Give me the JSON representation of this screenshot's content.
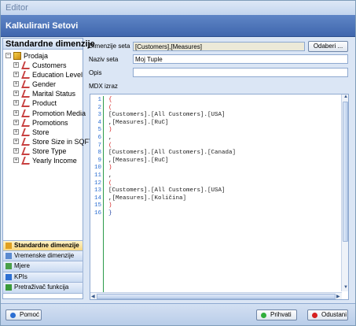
{
  "window": {
    "title": "Editor",
    "banner": "Kalkulirani Setovi"
  },
  "left_panel": {
    "header": "Standardne dimenzije",
    "root": "Prodaja",
    "items": [
      "Customers",
      "Education Level",
      "Gender",
      "Marital Status",
      "Product",
      "Promotion Media",
      "Promotions",
      "Store",
      "Store Size in SQFT",
      "Store Type",
      "Yearly Income"
    ]
  },
  "nav": {
    "items": [
      {
        "label": "Standardne dimenzije",
        "icon": "dimension-icon",
        "active": true
      },
      {
        "label": "Vremenske dimenzije",
        "icon": "calendar-icon"
      },
      {
        "label": "Mjere",
        "icon": "measure-icon"
      },
      {
        "label": "KPIs",
        "icon": "kpi-icon"
      },
      {
        "label": "Pretraživač funkcija",
        "icon": "function-icon"
      }
    ]
  },
  "form": {
    "dim_set_label": "Dimenzije seta",
    "dim_set_value": "[Customers],[Measures]",
    "choose_button": "Odaberi ...",
    "name_label": "Naziv seta",
    "name_value": "Moj Tuple",
    "desc_label": "Opis",
    "desc_value": "",
    "mdx_label": "MDX izraz"
  },
  "editor": {
    "line_numbers": [
      "1",
      "2",
      "3",
      "4",
      "5",
      "6",
      "7",
      "8",
      "9",
      "10",
      "11",
      "12",
      "13",
      "14",
      "15",
      "16"
    ],
    "lines": [
      {
        "text": "{",
        "cls": "c-red"
      },
      {
        "text": "(",
        "cls": "c-red"
      },
      {
        "text": "[Customers].[All Customers].[USA]",
        "cls": "c-black"
      },
      {
        "text": ",[Measures].[RuC]",
        "cls": "c-black"
      },
      {
        "text": ")",
        "cls": "c-red"
      },
      {
        "text": ",",
        "cls": "c-black"
      },
      {
        "text": "(",
        "cls": "c-red"
      },
      {
        "text": "[Customers].[All Customers].[Canada]",
        "cls": "c-black"
      },
      {
        "text": ",[Measures].[RuC]",
        "cls": "c-black"
      },
      {
        "text": ")",
        "cls": "c-red"
      },
      {
        "text": ",",
        "cls": "c-black"
      },
      {
        "text": "(",
        "cls": "c-red"
      },
      {
        "text": "[Customers].[All Customers].[USA]",
        "cls": "c-black"
      },
      {
        "text": ",[Measures].[Količina]",
        "cls": "c-black"
      },
      {
        "text": ")",
        "cls": "c-red"
      },
      {
        "text": "}",
        "cls": "c-blue"
      }
    ]
  },
  "footer": {
    "help": "Pomoć",
    "accept": "Prihvati",
    "cancel": "Odustani"
  },
  "colors": {
    "banner": "#4a72b8",
    "accept_dot": "#2fae3a",
    "cancel_dot": "#d62020",
    "help_dot": "#2d6fd2"
  }
}
